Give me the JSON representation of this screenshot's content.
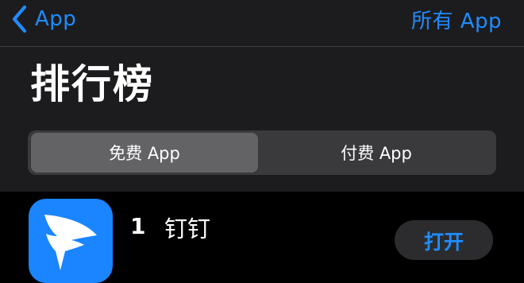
{
  "nav": {
    "back_label": "App",
    "right_label": "所有 App"
  },
  "page": {
    "title": "排行榜"
  },
  "segmented_control": {
    "options": [
      {
        "label": "免费 App",
        "selected": true
      },
      {
        "label": "付费 App",
        "selected": false
      }
    ]
  },
  "apps": [
    {
      "rank": "1",
      "name": "钉钉",
      "action_label": "打开",
      "icon": "dingtalk-wing-logo"
    }
  ],
  "colors": {
    "accent": "#1f8cff",
    "header_background": "#1c1c1e",
    "segment_selected": "#636366",
    "segment_track": "#3a3a3c",
    "app_icon_background": "#1a85ff"
  }
}
